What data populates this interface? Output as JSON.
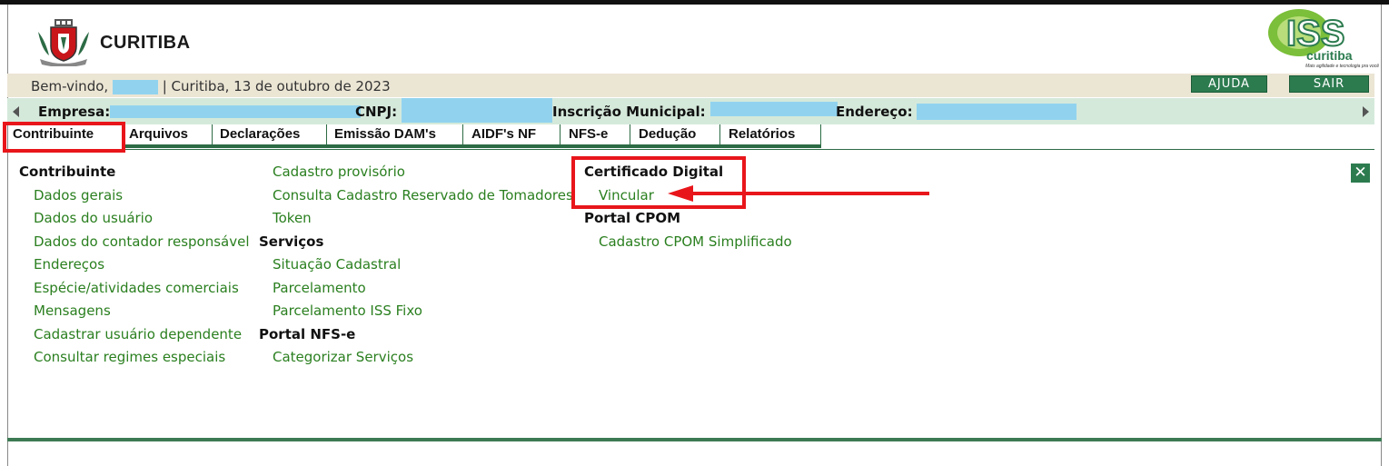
{
  "header": {
    "city_name": "CURITIBA",
    "iss_logo_text": "ISS",
    "iss_logo_city": "curitiba",
    "iss_tagline": "Mais agilidade e tecnologia pra você"
  },
  "welcome": {
    "prefix": "Bem-vindo,",
    "location_date": "| Curitiba, 13 de outubro de 2023",
    "help_label": "AJUDA",
    "exit_label": "SAIR"
  },
  "company": {
    "empresa_label": "Empresa:",
    "cnpj_label": "CNPJ:",
    "inscricao_label": "Inscrição Municipal:",
    "endereco_label": "Endereço:"
  },
  "tabs": [
    {
      "label": "Contribuinte",
      "active": true
    },
    {
      "label": "Arquivos"
    },
    {
      "label": "Declarações"
    },
    {
      "label": "Emissão DAM's"
    },
    {
      "label": "AIDF's NF"
    },
    {
      "label": "NFS-e"
    },
    {
      "label": "Dedução"
    },
    {
      "label": "Relatórios"
    }
  ],
  "menu": {
    "col1": {
      "heading": "Contribuinte",
      "items": [
        "Dados gerais",
        "Dados do usuário",
        "Dados do contador responsável",
        "Endereços",
        "Espécie/atividades comerciais",
        "Mensagens",
        "Cadastrar usuário dependente",
        "Consultar regimes especiais"
      ]
    },
    "col2": {
      "items_top": [
        "Cadastro provisório",
        "Consulta Cadastro Reservado de Tomadores",
        "Token"
      ],
      "servicos_heading": "Serviços",
      "servicos_items": [
        "Situação Cadastral",
        "Parcelamento",
        "Parcelamento ISS Fixo"
      ],
      "portal_heading": "Portal NFS-e",
      "portal_items": [
        "Categorizar Serviços"
      ]
    },
    "col3": {
      "cert_heading": "Certificado Digital",
      "cert_items": [
        "Vincular"
      ],
      "cpom_heading": "Portal CPOM",
      "cpom_items": [
        "Cadastro CPOM Simplificado"
      ]
    }
  },
  "colors": {
    "accent_green": "#2c7b4f",
    "link_green": "#2a7f1f",
    "highlight_red": "#e8161b",
    "redaction_blue": "#91d3ef"
  },
  "close_icon": "close-icon"
}
